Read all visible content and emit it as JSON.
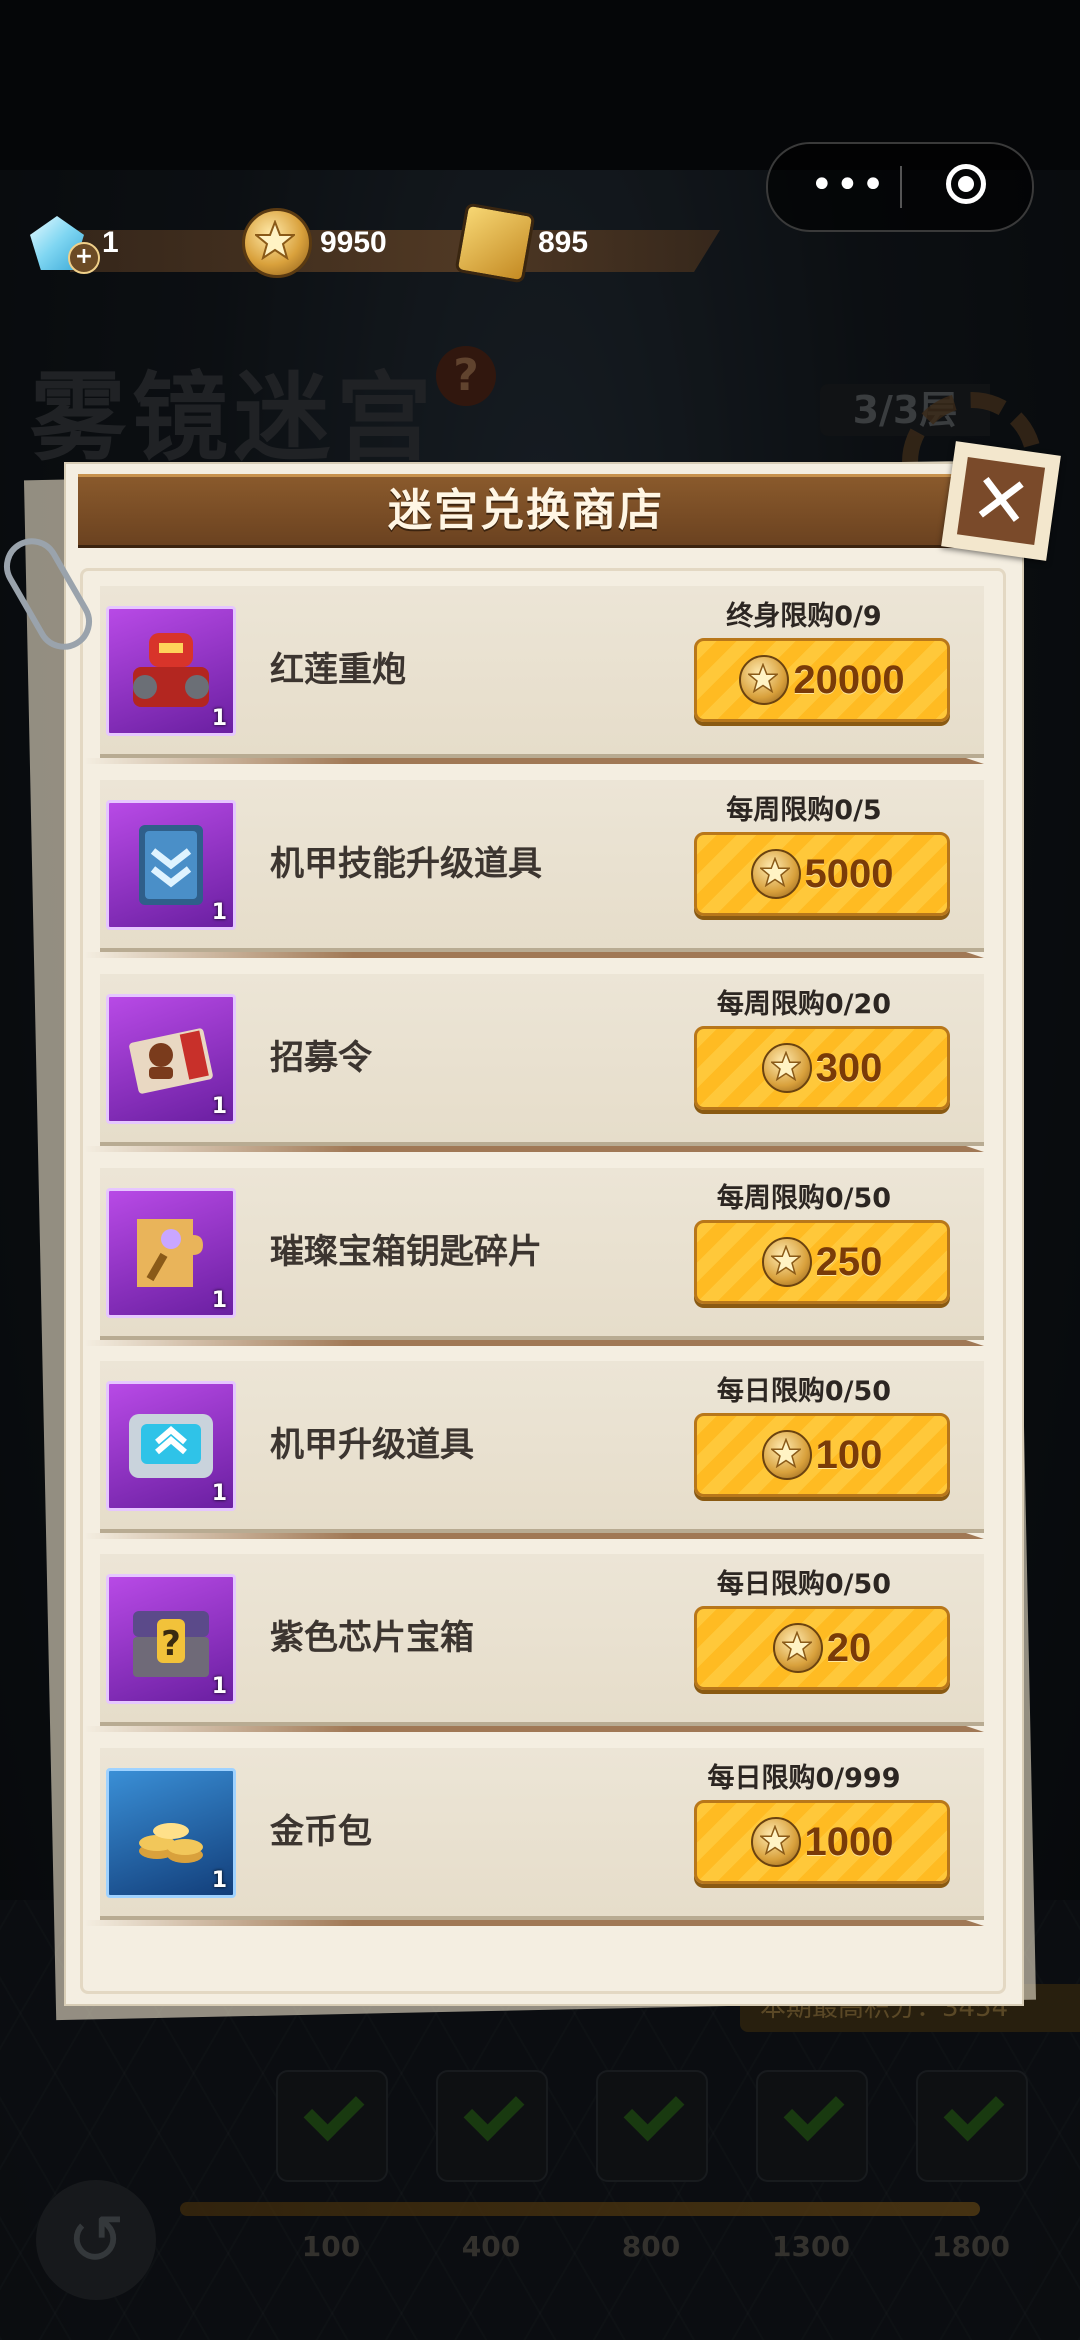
{
  "currency": {
    "gems": "1",
    "gold_coins": "9950",
    "tickets": "895"
  },
  "background": {
    "title": "雾镜迷宫",
    "help": "?",
    "floor": "3/3层",
    "score_label": "本期最高积分：3454",
    "milestones": [
      "100",
      "400",
      "800",
      "1300",
      "1800"
    ]
  },
  "shop": {
    "title": "迷宫兑换商店",
    "close_label": "✕",
    "items": [
      {
        "name": "红莲重炮",
        "limit": "终身限购0/9",
        "price": "20000",
        "count": "1",
        "icon": "red-mech-icon"
      },
      {
        "name": "机甲技能升级道具",
        "limit": "每周限购0/5",
        "price": "5000",
        "count": "1",
        "icon": "skill-book-icon"
      },
      {
        "name": "招募令",
        "limit": "每周限购0/20",
        "price": "300",
        "count": "1",
        "icon": "recruit-ticket-icon"
      },
      {
        "name": "璀璨宝箱钥匙碎片",
        "limit": "每周限购0/50",
        "price": "250",
        "count": "1",
        "icon": "key-fragment-icon"
      },
      {
        "name": "机甲升级道具",
        "limit": "每日限购0/50",
        "price": "100",
        "count": "1",
        "icon": "upgrade-chip-icon"
      },
      {
        "name": "紫色芯片宝箱",
        "limit": "每日限购0/50",
        "price": "20",
        "count": "1",
        "icon": "mystery-chest-icon"
      },
      {
        "name": "金币包",
        "limit": "每日限购0/999",
        "price": "1000",
        "count": "1",
        "icon": "coin-pile-icon"
      }
    ]
  }
}
